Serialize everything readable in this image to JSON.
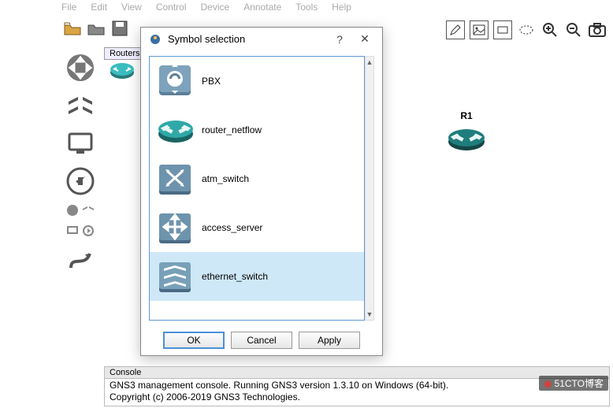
{
  "menu": {
    "items": [
      "File",
      "Edit",
      "View",
      "Control",
      "Device",
      "Annotate",
      "Tools",
      "Help"
    ]
  },
  "routersTab": "Routers",
  "deviceOnCanvas": {
    "label": "R1"
  },
  "dialog": {
    "title": "Symbol selection",
    "help": "?",
    "close": "✕",
    "items": [
      {
        "name": "PBX"
      },
      {
        "name": "router_netflow"
      },
      {
        "name": "atm_switch"
      },
      {
        "name": "access_server"
      },
      {
        "name": "ethernet_switch"
      }
    ],
    "buttons": {
      "ok": "OK",
      "cancel": "Cancel",
      "apply": "Apply"
    }
  },
  "console": {
    "title": "Console",
    "line1": "GNS3 management console. Running GNS3 version 1.3.10 on Windows (64-bit).",
    "line2": "Copyright (c) 2006-2019 GNS3 Technologies."
  },
  "watermark": "51CTO博客"
}
